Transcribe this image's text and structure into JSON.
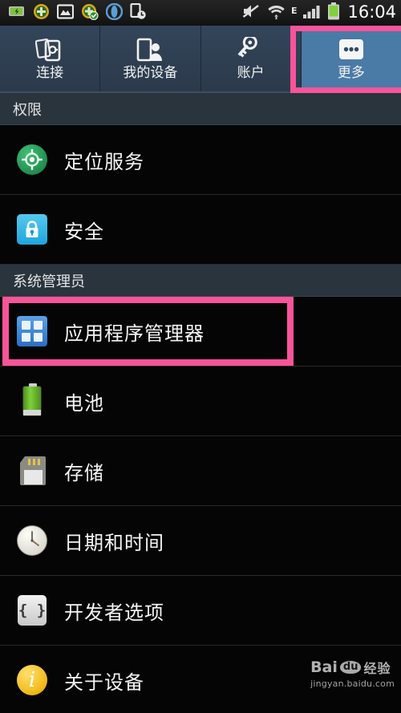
{
  "statusbar": {
    "time": "16:04",
    "network_label": "E",
    "left_icons": [
      {
        "name": "battery-saver-icon"
      },
      {
        "name": "app-update-icon"
      },
      {
        "name": "gallery-image-icon"
      },
      {
        "name": "app-installed-check-icon"
      },
      {
        "name": "opera-browser-icon"
      },
      {
        "name": "device-history-icon"
      }
    ],
    "right_icons": [
      {
        "name": "mute-icon"
      },
      {
        "name": "wifi-icon"
      },
      {
        "name": "edge-network-icon"
      },
      {
        "name": "signal-bars-icon"
      },
      {
        "name": "battery-icon"
      }
    ]
  },
  "tabs": [
    {
      "label": "连接",
      "icon": "connections-icon",
      "active": false
    },
    {
      "label": "我的设备",
      "icon": "my-device-icon",
      "active": false
    },
    {
      "label": "账户",
      "icon": "accounts-icon",
      "active": false
    },
    {
      "label": "更多",
      "icon": "more-dots-icon",
      "active": true
    }
  ],
  "highlight_color": "#f8549a",
  "sections": [
    {
      "header": "权限",
      "items": [
        {
          "label": "定位服务",
          "icon": "location-icon",
          "highlighted": false
        },
        {
          "label": "安全",
          "icon": "lock-icon",
          "highlighted": false
        }
      ]
    },
    {
      "header": "系统管理员",
      "items": [
        {
          "label": "应用程序管理器",
          "icon": "apps-grid-icon",
          "highlighted": true
        },
        {
          "label": "电池",
          "icon": "battery-icon",
          "highlighted": false
        },
        {
          "label": "存储",
          "icon": "sd-card-icon",
          "highlighted": false
        },
        {
          "label": "日期和时间",
          "icon": "clock-icon",
          "highlighted": false
        },
        {
          "label": "开发者选项",
          "icon": "braces-icon",
          "highlighted": false
        },
        {
          "label": "关于设备",
          "icon": "info-icon",
          "highlighted": false
        }
      ]
    }
  ],
  "watermark": {
    "brand": "Bai",
    "brand_mark": "du",
    "brand_suffix": "经验",
    "url": "jingyan.baidu.com"
  }
}
